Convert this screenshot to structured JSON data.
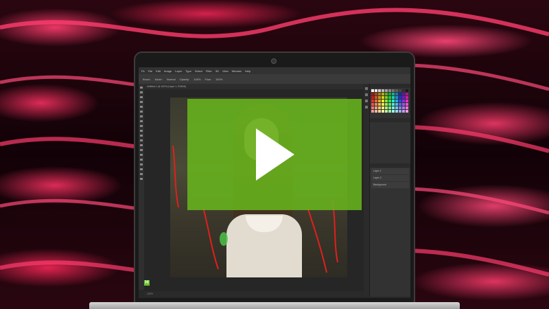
{
  "photoshop": {
    "menu": [
      "Ps",
      "File",
      "Edit",
      "Image",
      "Layer",
      "Type",
      "Select",
      "Filter",
      "3D",
      "View",
      "Window",
      "Help"
    ],
    "options": [
      "Brush:",
      "Mode:",
      "Normal",
      "Opacity:",
      "100%",
      "Flow:",
      "100%"
    ],
    "tab_label": "Untitled-1 @ 100% (Layer 1, RGB/8)",
    "status_text": "100%",
    "layers": [
      "Layer 1",
      "Layer 2",
      "Background"
    ]
  },
  "video": {
    "play_label": "Play video",
    "badge": "H"
  },
  "colors": {
    "accent": "#68b41c",
    "background_wave": "#ff3c6e"
  }
}
